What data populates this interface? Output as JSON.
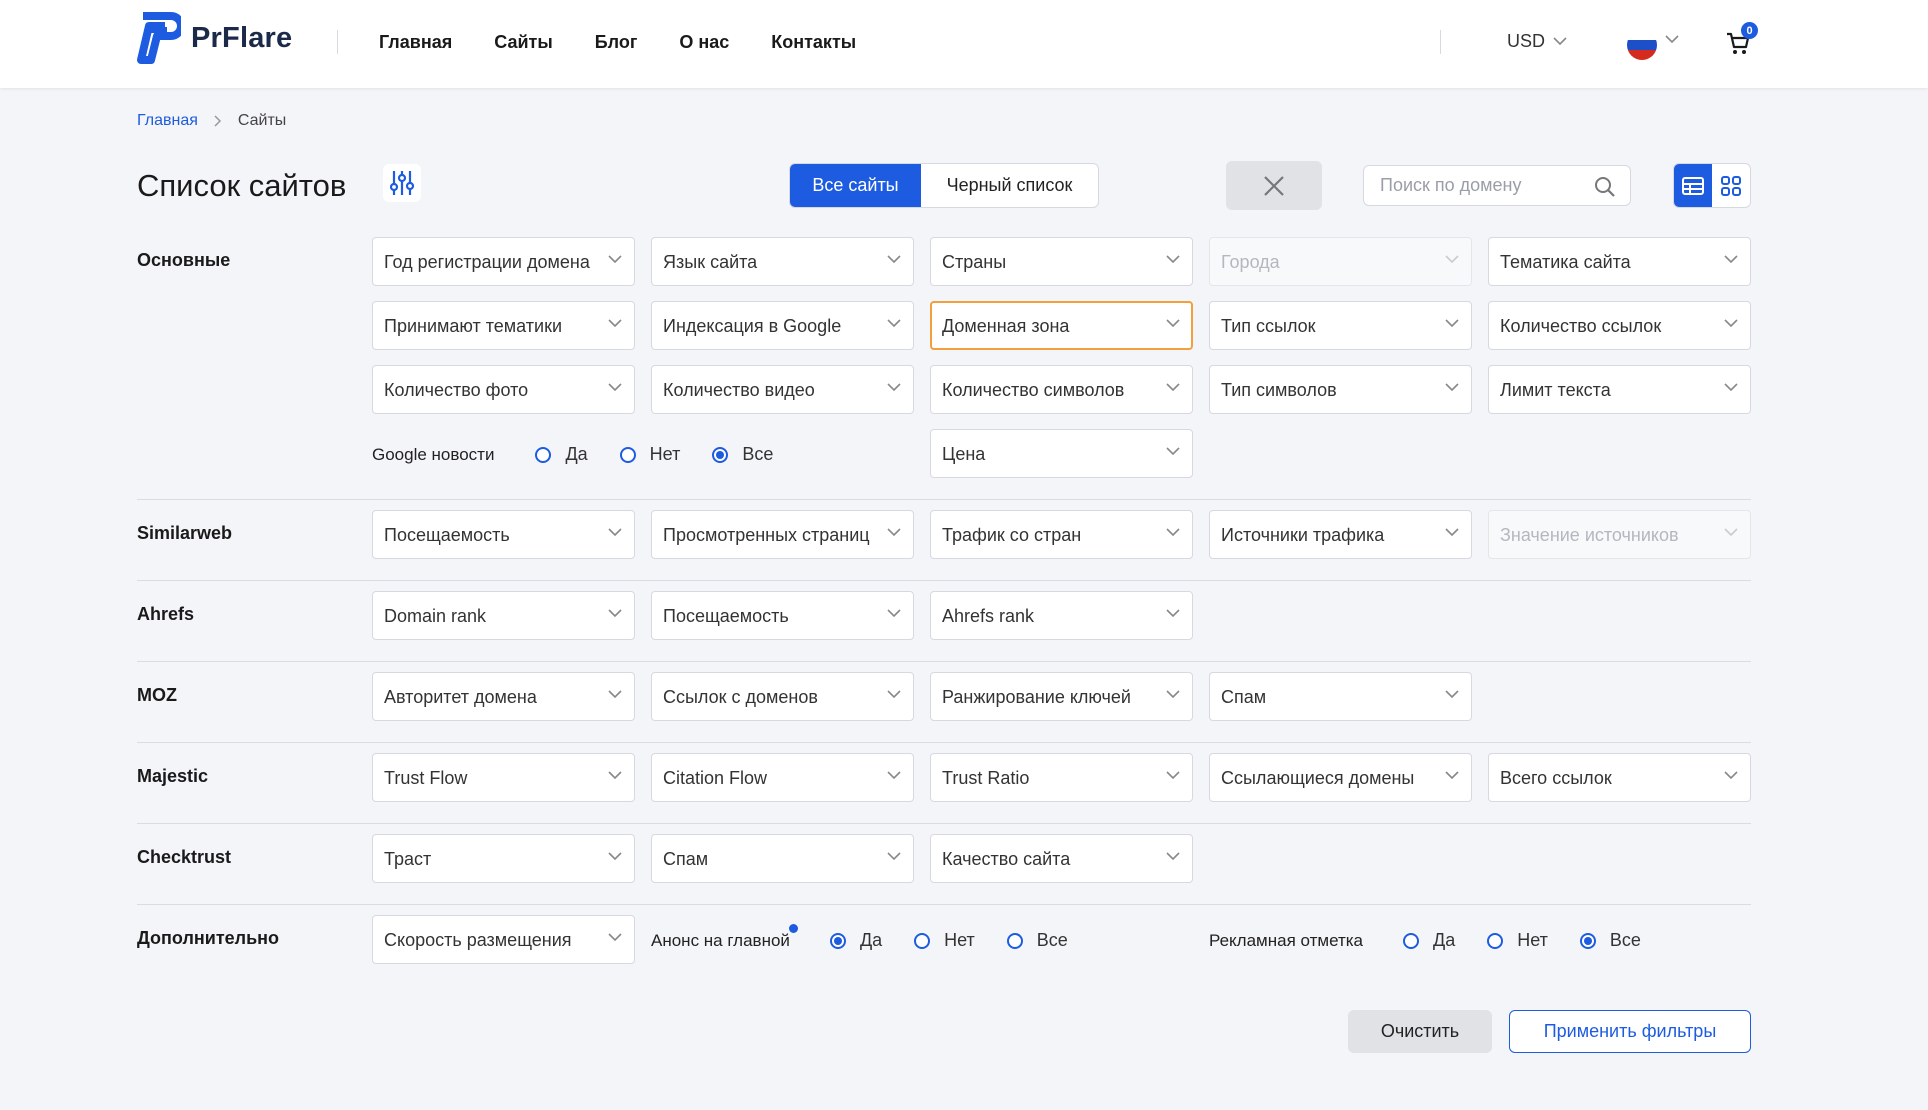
{
  "brand": {
    "name": "PrFlare",
    "accent": "#1d5ce0"
  },
  "nav": [
    "Главная",
    "Сайты",
    "Блог",
    "О нас",
    "Контакты"
  ],
  "header": {
    "currency": "USD",
    "cart_count": "0",
    "language_flag": "flag-ru-icon"
  },
  "breadcrumb": {
    "home": "Главная",
    "current": "Сайты"
  },
  "page": {
    "title": "Список сайтов",
    "tabs": {
      "all": "Все сайты",
      "blacklist": "Черный список",
      "active": "all"
    },
    "search_placeholder": "Поиск по домену",
    "view_mode": "table"
  },
  "groups": {
    "basic": {
      "label": "Основные",
      "row1": [
        "Год регистрации домена",
        "Язык сайта",
        "Страны",
        "Города",
        "Тематика сайта"
      ],
      "row2": [
        "Принимают тематики",
        "Индексация в Google",
        "Доменная зона",
        "Тип ссылок",
        "Количество ссылок"
      ],
      "row3": [
        "Количество фото",
        "Количество видео",
        "Количество символов",
        "Тип символов",
        "Лимит текста"
      ],
      "google_news": {
        "label": "Google новости",
        "yes": "Да",
        "no": "Нет",
        "all": "Все",
        "selected": "all"
      },
      "price": "Цена",
      "disabled": [
        "Города"
      ],
      "focused": "Доменная зона"
    },
    "similarweb": {
      "label": "Similarweb",
      "items": [
        "Посещаемость",
        "Просмотренных страниц",
        "Трафик со стран",
        "Источники трафика",
        "Значение источников"
      ],
      "disabled": [
        "Значение источников"
      ]
    },
    "ahrefs": {
      "label": "Ahrefs",
      "items": [
        "Domain rank",
        "Посещаемость",
        "Ahrefs rank"
      ]
    },
    "moz": {
      "label": "MOZ",
      "items": [
        "Авторитет домена",
        "Ссылок с доменов",
        "Ранжирование ключей",
        "Спам"
      ]
    },
    "majestic": {
      "label": "Majestic",
      "items": [
        "Trust Flow",
        "Citation Flow",
        "Trust Ratio",
        "Ссылающиеся домены",
        "Всего ссылок"
      ]
    },
    "checktrust": {
      "label": "Checktrust",
      "items": [
        "Траст",
        "Спам",
        "Качество сайта"
      ]
    },
    "extra": {
      "label": "Дополнительно",
      "speed": "Скорость размещения",
      "announce": {
        "label": "Анонс на главной",
        "yes": "Да",
        "no": "Нет",
        "all": "Все",
        "selected": "yes"
      },
      "ad_mark": {
        "label": "Рекламная отметка",
        "yes": "Да",
        "no": "Нет",
        "all": "Все",
        "selected": "all"
      }
    }
  },
  "actions": {
    "clear": "Очистить",
    "apply": "Применить фильтры"
  }
}
